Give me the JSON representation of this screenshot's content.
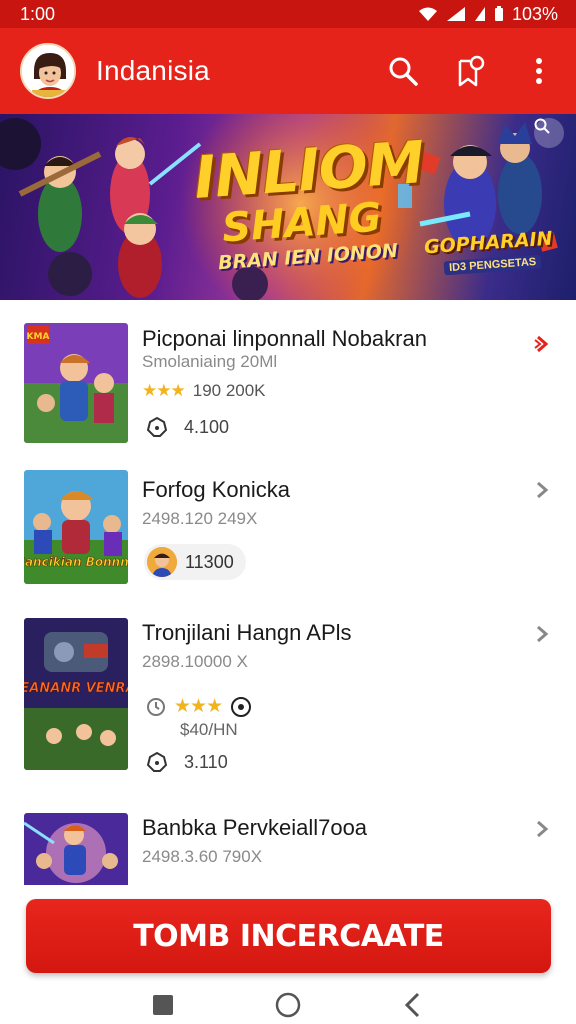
{
  "status_bar": {
    "time": "1:00",
    "battery": "103%"
  },
  "app_bar": {
    "title": "Indanisia"
  },
  "banner": {
    "title_line1": "INLIOM",
    "title_line2": "SHANG",
    "subtitle": "BRAN IEN IONON",
    "side_title": "GOPHARAIN",
    "side_tag": "ID3 PENGSETAS"
  },
  "items": [
    {
      "title": "Picponai linponnall Nobakran",
      "subtitle": "Smolaniaing 20Ml",
      "rating_stars": 3,
      "rating_text": "190 200K",
      "stat": "4.100"
    },
    {
      "title": "Forfog Konicka",
      "subtitle": "2498.120 249X",
      "badge_text": "11300"
    },
    {
      "title": "Tronjilani Hangn APls",
      "subtitle": "2898.10000 X",
      "rating_stars": 3,
      "price_text": "$40/HN",
      "stat": "3.110"
    },
    {
      "title": "Banbka Pervkeiall7ooa",
      "subtitle": "2498.3.60 790X"
    }
  ],
  "thumbs": [
    {
      "label": "KMA"
    },
    {
      "label": "Gancikian Bonnne"
    },
    {
      "label": "SFEANANR VENRAIS"
    },
    {
      "label": ""
    }
  ],
  "cta": {
    "label": "TOMB INCERCAATE"
  },
  "colors": {
    "primary": "#e5231b",
    "status": "#c8150f",
    "star": "#f2b41c"
  },
  "icons": [
    "search-icon",
    "bookmark-icon",
    "more-vert-icon",
    "chevron-right-icon",
    "square-nav-icon",
    "circle-nav-icon",
    "back-nav-icon"
  ]
}
